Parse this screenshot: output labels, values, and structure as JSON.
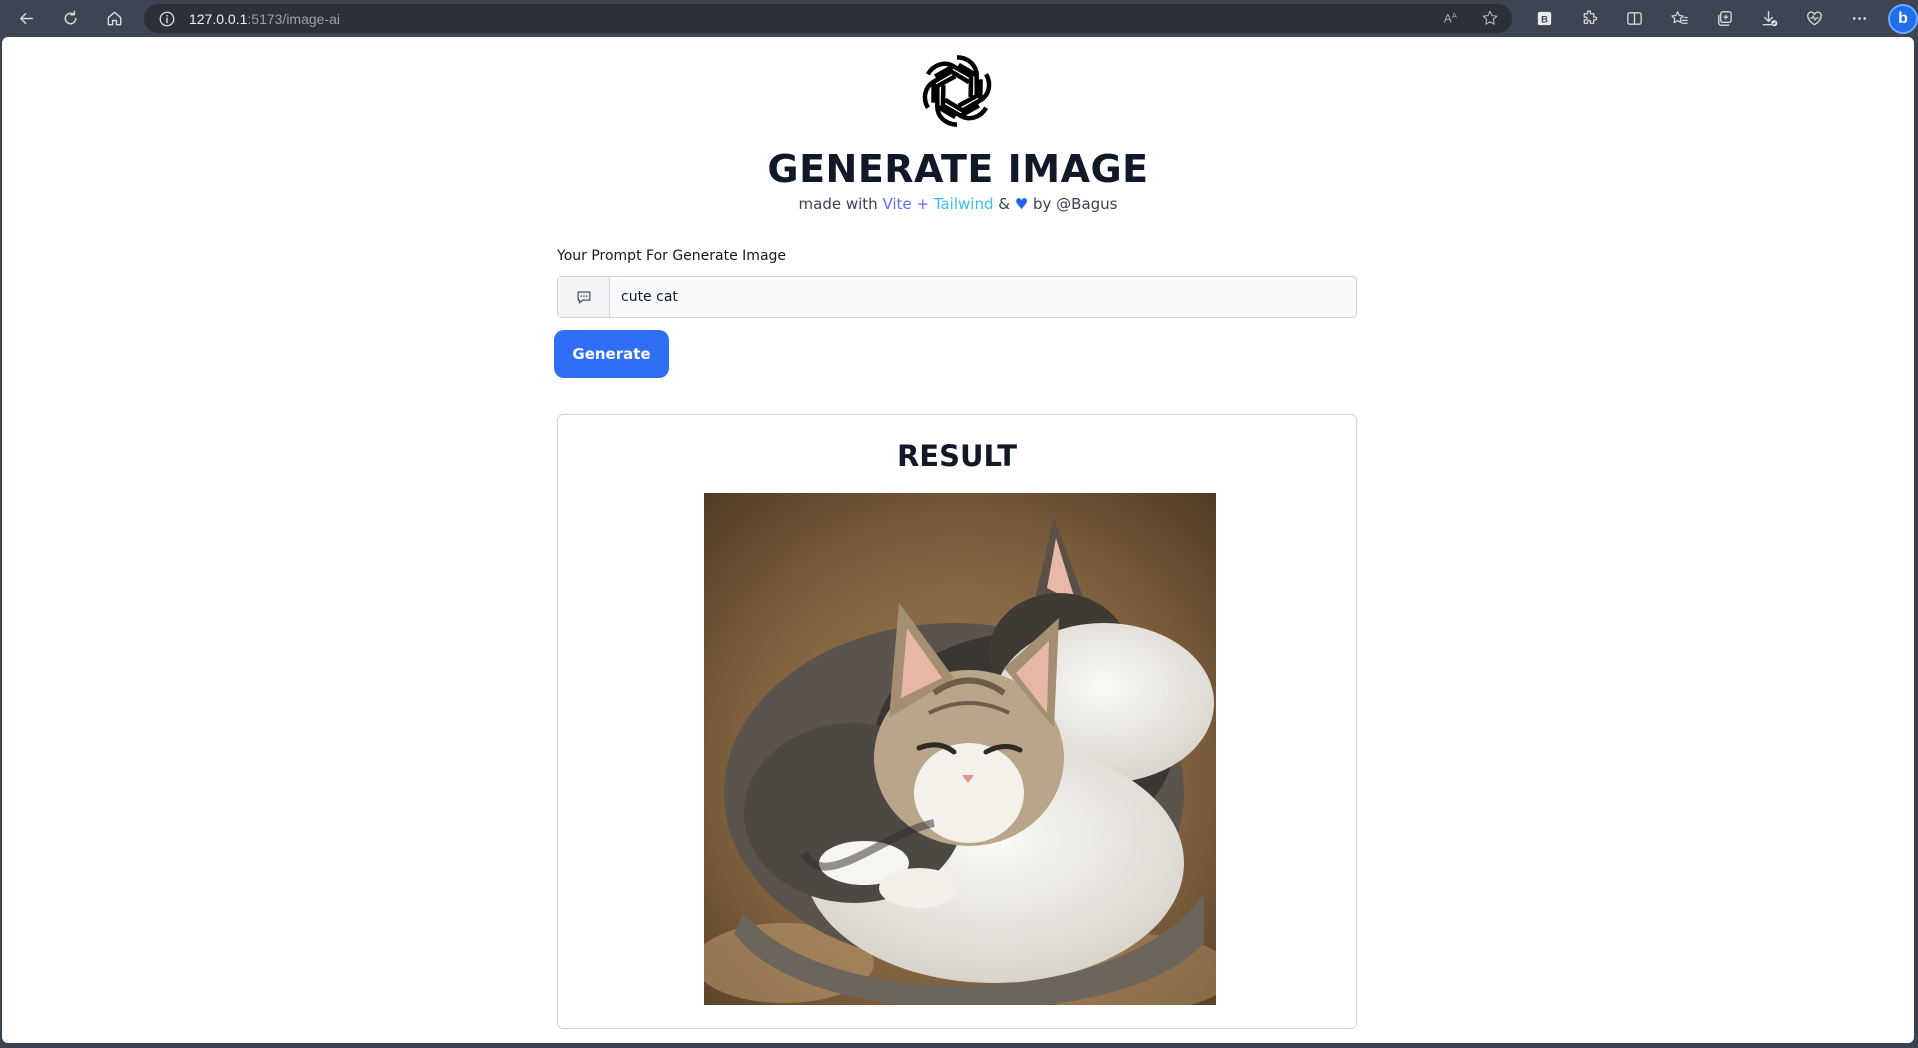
{
  "browser": {
    "url_host": "127.0.0.1",
    "url_path": ":5173/image-ai"
  },
  "page": {
    "title": "GENERATE IMAGE",
    "credit": {
      "prefix": "made with",
      "vite": "Vite",
      "plus": "+",
      "tailwind": "Tailwind",
      "amp": "&",
      "heart": "♥",
      "suffix": "by @Bagus"
    },
    "prompt_label": "Your Prompt For Generate Image",
    "prompt_value": "cute cat",
    "generate_label": "Generate",
    "result_title": "RESULT"
  },
  "colors": {
    "primary_button": "#2f6ff5",
    "vite": "#646cff",
    "tailwind": "#38bdf8"
  }
}
